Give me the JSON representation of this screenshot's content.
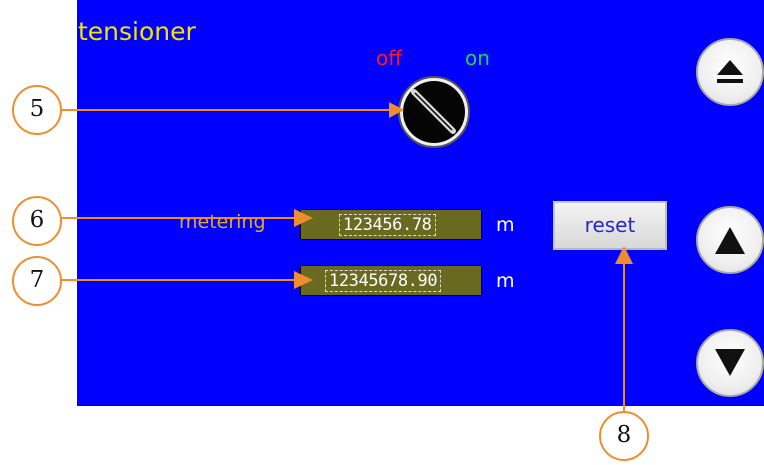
{
  "screen": {
    "title": "tensioner"
  },
  "selector": {
    "off_label": "off",
    "on_label": "on",
    "state": "on"
  },
  "metering": {
    "label": "metering",
    "value": "123456.78",
    "unit": "m"
  },
  "total": {
    "value": "12345678.90",
    "unit": "m"
  },
  "reset": {
    "label": "reset"
  },
  "navigation": {
    "buttons": [
      {
        "name": "eject",
        "icon": "eject-icon"
      },
      {
        "name": "up",
        "icon": "triangle-up-icon"
      },
      {
        "name": "down",
        "icon": "triangle-down-icon"
      }
    ]
  },
  "callouts": [
    {
      "number": "5"
    },
    {
      "number": "6"
    },
    {
      "number": "7"
    },
    {
      "number": "8"
    }
  ],
  "colors": {
    "panel_background": "#0000fe",
    "title": "#f2e300",
    "off": "#ff1a1a",
    "on": "#1bd16a",
    "readout_background": "#696a1f",
    "callout": "#ef8d2f"
  }
}
